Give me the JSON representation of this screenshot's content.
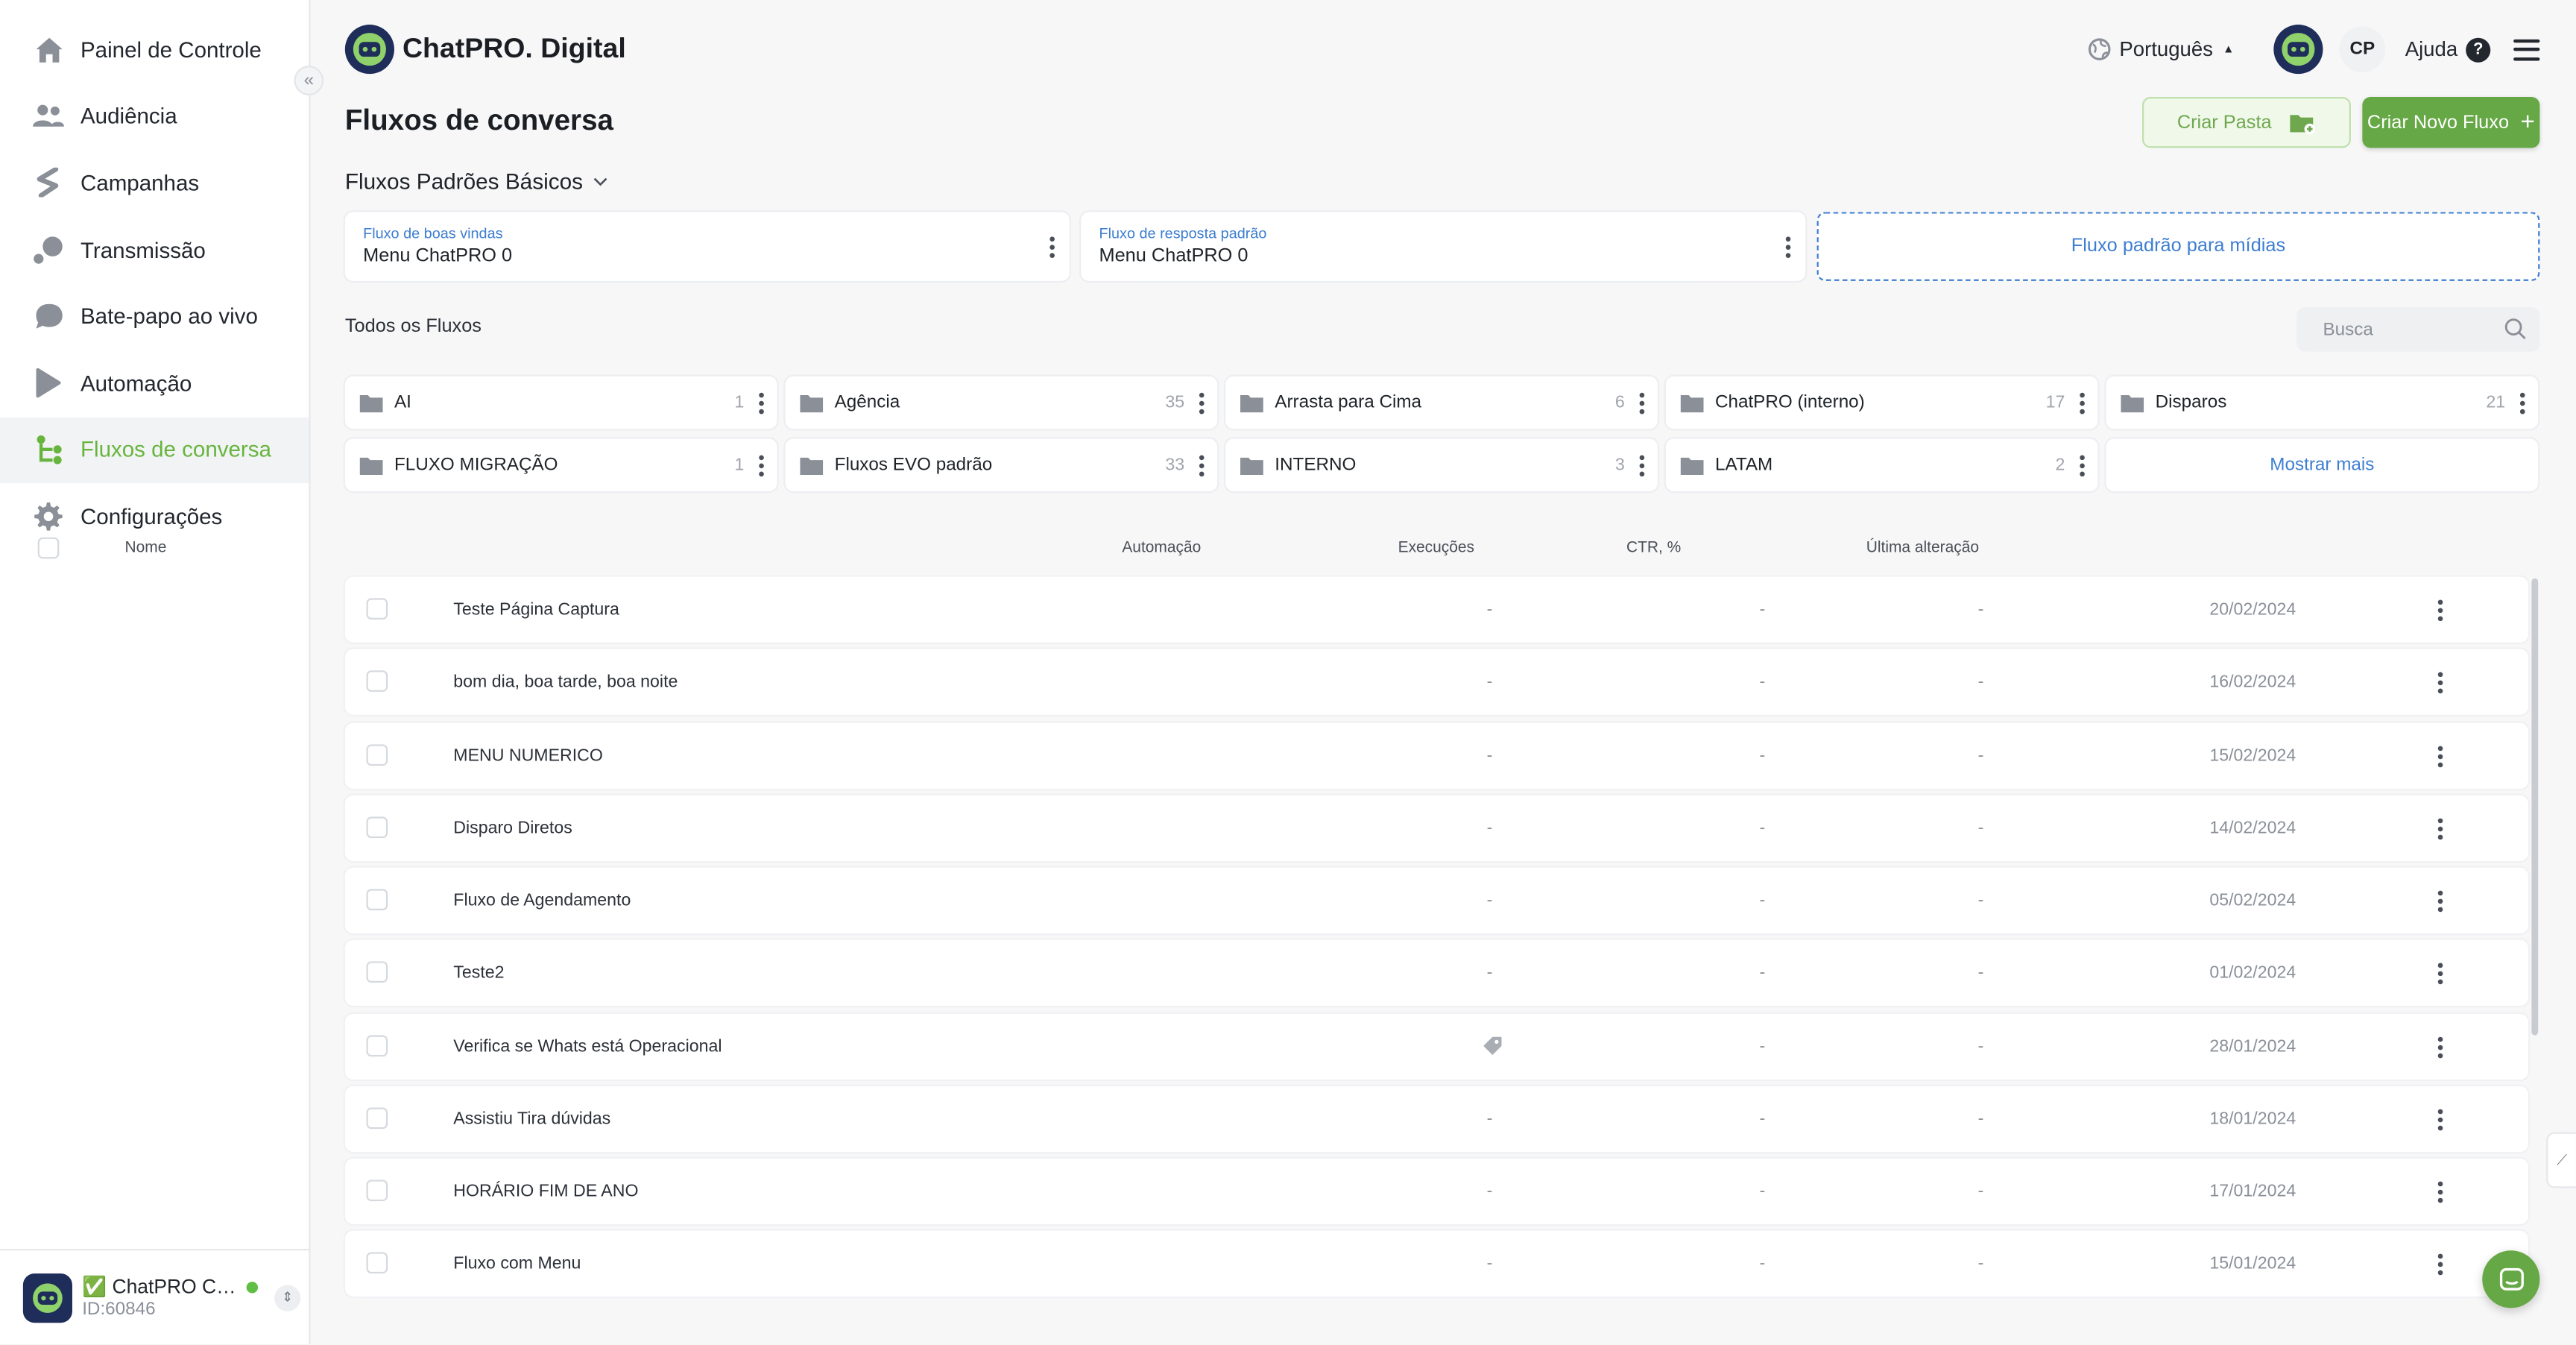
{
  "app": {
    "brand": "ChatPRO. Digital"
  },
  "sidebar": {
    "items": [
      {
        "label": "Painel de Controle",
        "icon": "home-icon"
      },
      {
        "label": "Audiência",
        "icon": "users-icon"
      },
      {
        "label": "Campanhas",
        "icon": "campaign-icon"
      },
      {
        "label": "Transmissão",
        "icon": "broadcast-icon"
      },
      {
        "label": "Bate-papo ao vivo",
        "icon": "chat-bubble-icon"
      },
      {
        "label": "Automação",
        "icon": "automation-icon"
      },
      {
        "label": "Fluxos de conversa",
        "icon": "flow-icon",
        "active": true
      },
      {
        "label": "Configurações",
        "icon": "gear-icon"
      }
    ],
    "account": {
      "name": "✅ ChatPRO Clie...",
      "id": "ID:60846"
    }
  },
  "header": {
    "language": "Português",
    "user_initials": "CP",
    "help": "Ajuda"
  },
  "page": {
    "title": "Fluxos de conversa",
    "create_folder": "Criar Pasta",
    "create_flow": "Criar Novo Fluxo",
    "basic_section": "Fluxos Padrões Básicos",
    "welcome": {
      "label": "Fluxo de boas vindas",
      "value": "Menu ChatPRO 0"
    },
    "default_reply": {
      "label": "Fluxo de resposta padrão",
      "value": "Menu ChatPRO 0"
    },
    "media_default": "Fluxo padrão para mídias",
    "all_flows": "Todos os Fluxos",
    "search_placeholder": "Busca",
    "show_more": "Mostrar mais"
  },
  "folders": [
    {
      "name": "AI",
      "count": "1"
    },
    {
      "name": "Agência",
      "count": "35"
    },
    {
      "name": "Arrasta para Cima",
      "count": "6"
    },
    {
      "name": "ChatPRO (interno)",
      "count": "17"
    },
    {
      "name": "Disparos",
      "count": "21"
    },
    {
      "name": "FLUXO MIGRAÇÃO",
      "count": "1"
    },
    {
      "name": "Fluxos EVO padrão",
      "count": "33"
    },
    {
      "name": "INTERNO",
      "count": "3"
    },
    {
      "name": "LATAM",
      "count": "2"
    }
  ],
  "table": {
    "columns": {
      "name": "Nome",
      "automation": "Automação",
      "executions": "Execuções",
      "ctr": "CTR, %",
      "modified": "Última alteração"
    },
    "rows": [
      {
        "name": "Teste Página Captura",
        "automation": "-",
        "executions": "-",
        "ctr": "-",
        "modified": "20/02/2024"
      },
      {
        "name": "bom dia, boa tarde, boa noite",
        "automation": "-",
        "executions": "-",
        "ctr": "-",
        "modified": "16/02/2024"
      },
      {
        "name": "MENU NUMERICO",
        "automation": "-",
        "executions": "-",
        "ctr": "-",
        "modified": "15/02/2024"
      },
      {
        "name": "Disparo Diretos",
        "automation": "-",
        "executions": "-",
        "ctr": "-",
        "modified": "14/02/2024"
      },
      {
        "name": "Fluxo de Agendamento",
        "automation": "-",
        "executions": "-",
        "ctr": "-",
        "modified": "05/02/2024"
      },
      {
        "name": "Teste2",
        "automation": "-",
        "executions": "-",
        "ctr": "-",
        "modified": "01/02/2024"
      },
      {
        "name": "Verifica se Whats está Operacional",
        "automation": "",
        "executions": "-",
        "ctr": "-",
        "modified": "28/01/2024"
      },
      {
        "name": "Assistiu Tira dúvidas",
        "automation": "-",
        "executions": "-",
        "ctr": "-",
        "modified": "18/01/2024"
      },
      {
        "name": "HORÁRIO FIM DE ANO",
        "automation": "-",
        "executions": "-",
        "ctr": "-",
        "modified": "17/01/2024"
      },
      {
        "name": "Fluxo com Menu",
        "automation": "-",
        "executions": "-",
        "ctr": "-",
        "modified": "15/01/2024"
      }
    ]
  },
  "colors": {
    "accent": "#66a845",
    "link": "#3d7ed0",
    "active_nav": "#67b53f"
  }
}
